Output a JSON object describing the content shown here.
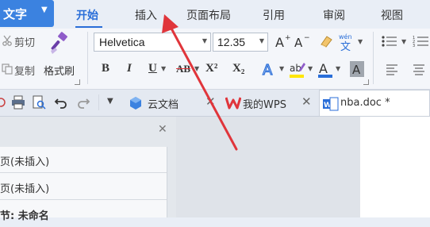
{
  "app_menu": {
    "label": "文字",
    "caret": "▼"
  },
  "tabs": [
    {
      "label": "开始",
      "active": true
    },
    {
      "label": "插入",
      "active": false
    },
    {
      "label": "页面布局",
      "active": false
    },
    {
      "label": "引用",
      "active": false
    },
    {
      "label": "审阅",
      "active": false
    },
    {
      "label": "视图",
      "active": false
    }
  ],
  "ribbon": {
    "clipboard": {
      "cut": "剪切",
      "copy": "复制",
      "format_painter": "格式刷"
    },
    "font": {
      "family": "Helvetica",
      "size": "12.35"
    },
    "format_buttons": {
      "bold": "B",
      "italic": "I",
      "underline": "U",
      "strike": "AB",
      "superscript": "X²",
      "subscript": "X₂"
    }
  },
  "doc_tabs": [
    {
      "label": "云文档",
      "icon": "cloud-icon"
    },
    {
      "label": "我的WPS",
      "icon": "wps-logo-icon"
    },
    {
      "label": "nba.doc *",
      "icon": "word-doc-icon",
      "active": true
    }
  ],
  "nav_items": [
    {
      "label": "页(未插入)"
    },
    {
      "label": "页(未插入)"
    },
    {
      "label": "节: 未命名"
    }
  ],
  "colors": {
    "accent": "#2a6ed8",
    "arrow": "#e0353b",
    "app_button": "#3b82e0"
  }
}
